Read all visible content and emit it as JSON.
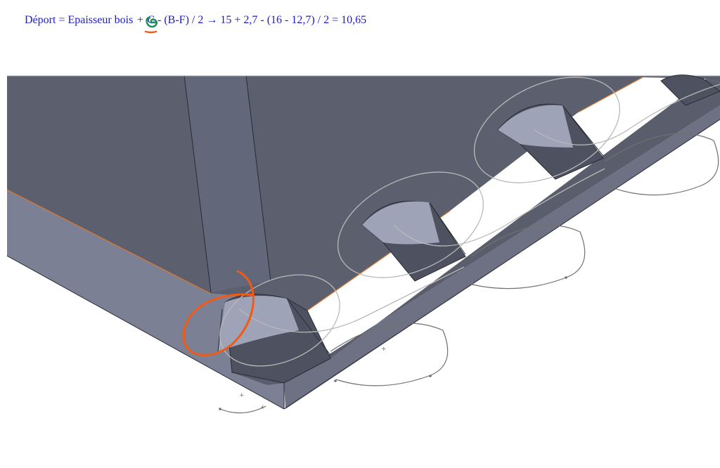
{
  "formula": {
    "lhs": "Déport",
    "eq": "=",
    "term1": "Epaisseur bois",
    "op1": "+",
    "rest": "C - (B-F) / 2 → 15 + 2,7 - (16 - 12,7) / 2 = 10,65"
  },
  "colors": {
    "formula_text": "#1a1ad8",
    "annotation_green": "#1e8c58",
    "annotation_orange": "#f05a14",
    "face_top": "#5c5f6e",
    "face_side": "#7c8094",
    "face_front": "#8a8fa3",
    "edge_highlight": "#e0782a",
    "sketch_curve": "#b9b9b9"
  },
  "icons": [
    "circle-annotation-icon",
    "underline-annotation-icon"
  ]
}
